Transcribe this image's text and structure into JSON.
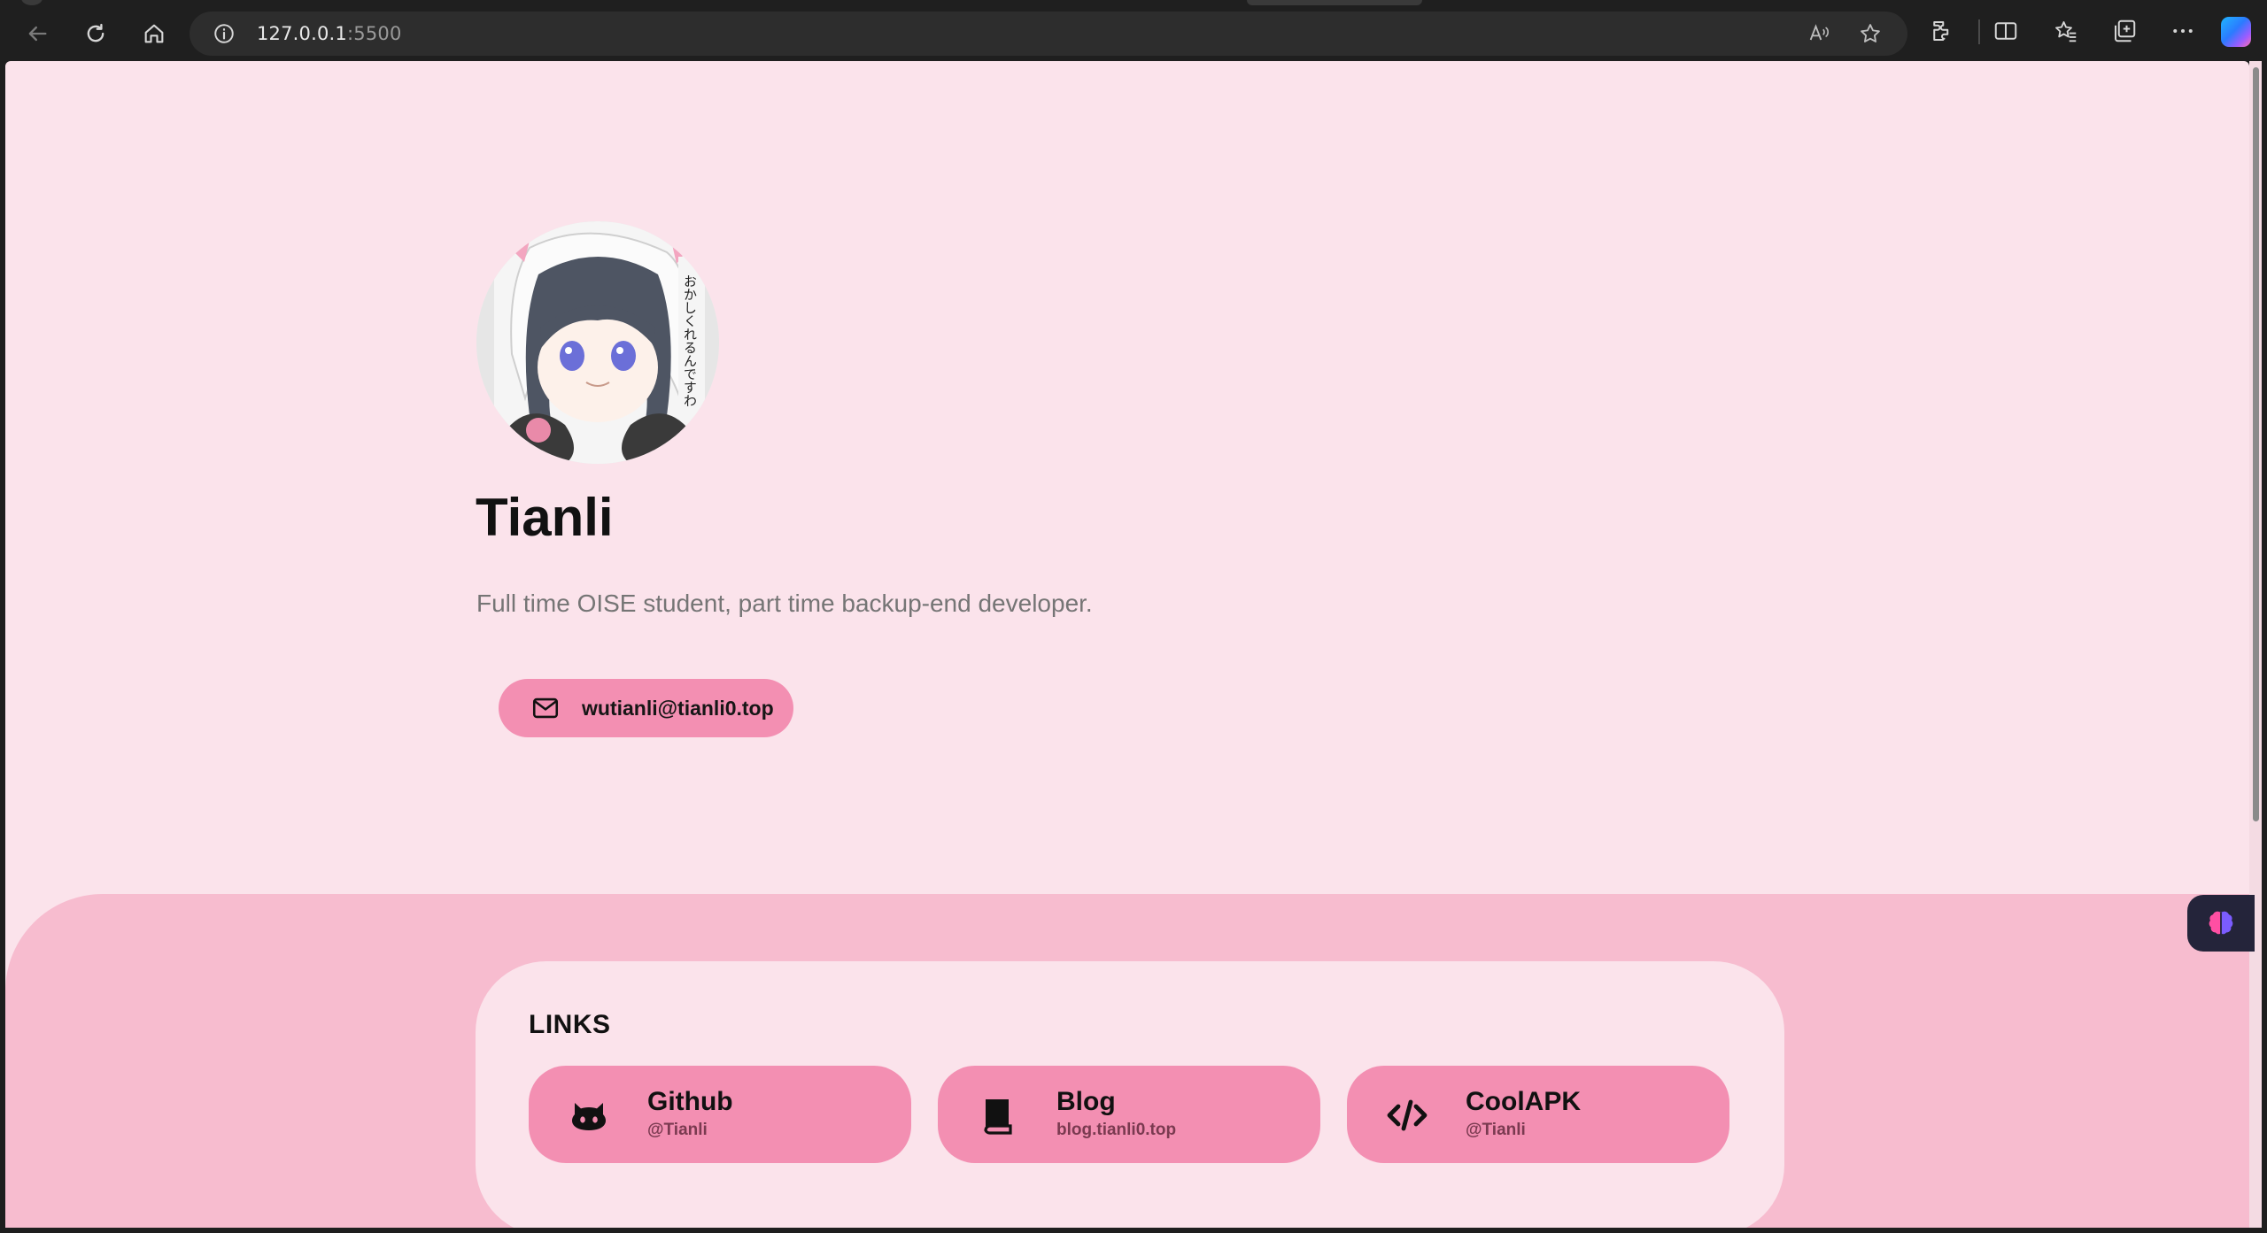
{
  "browser": {
    "url_host": "127.0.0.1",
    "url_port": ":5500"
  },
  "profile": {
    "name": "Tianli",
    "bio": "Full time OISE student, part time backup-end developer.",
    "email": "wutianli@tianli0.top",
    "avatar_caption": "おかしくれるんですわ"
  },
  "links": {
    "title": "LINKS",
    "items": [
      {
        "name": "Github",
        "sub": "@Tianli",
        "icon": "github-icon"
      },
      {
        "name": "Blog",
        "sub": "blog.tianli0.top",
        "icon": "book-icon"
      },
      {
        "name": "CoolAPK",
        "sub": "@Tianli",
        "icon": "code-icon"
      }
    ]
  },
  "colors": {
    "page_bg": "#fbe3eb",
    "accent": "#f38fb2",
    "lower_bg": "#f7bccf"
  }
}
